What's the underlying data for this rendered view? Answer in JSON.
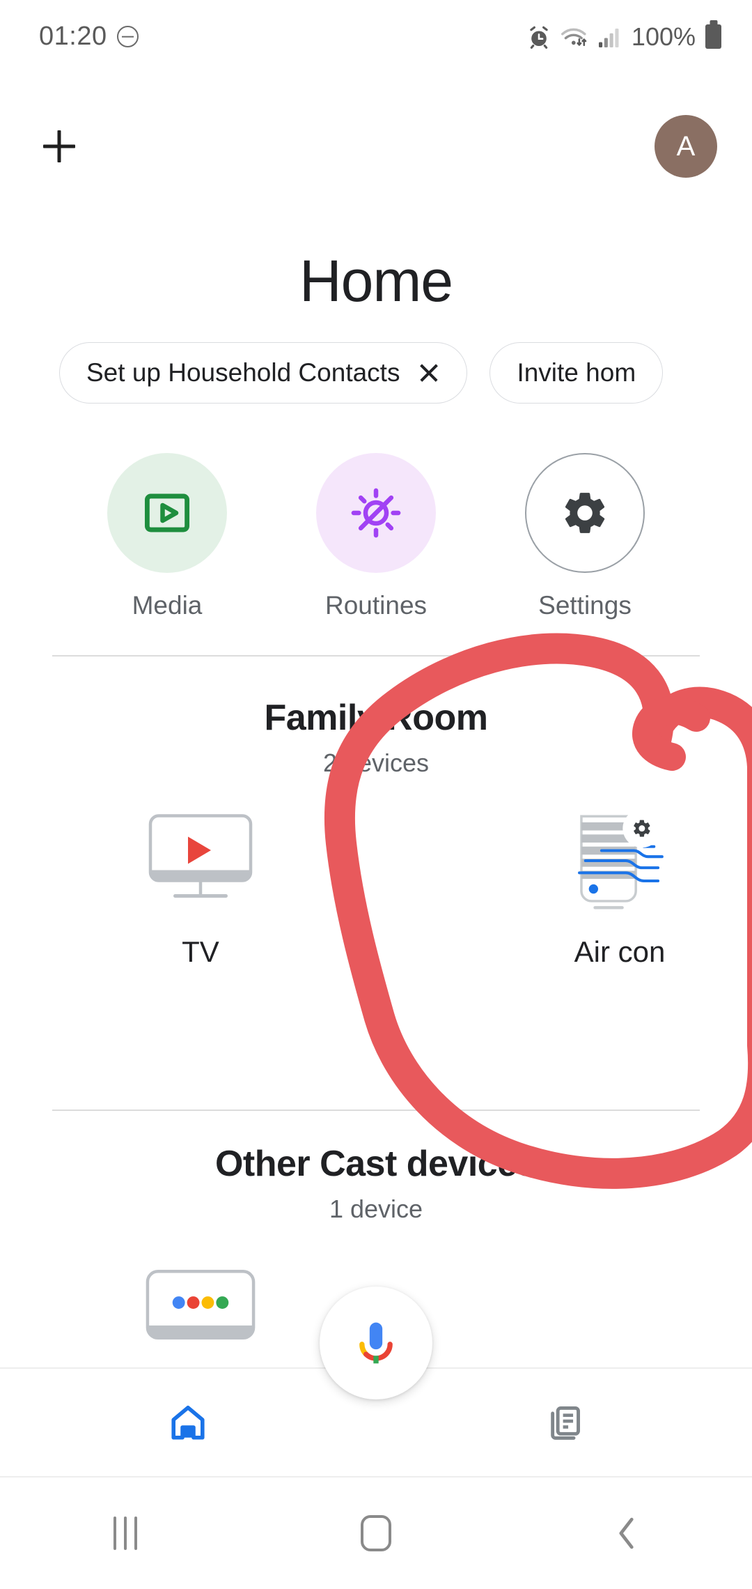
{
  "status_bar": {
    "time": "01:20",
    "dnd_icon": "do-not-disturb-icon",
    "alarm_icon": "alarm-icon",
    "wifi_icon": "wifi-icon",
    "signal_icon": "cellular-signal-icon",
    "battery_text": "100%",
    "battery_icon": "battery-full-icon"
  },
  "app_bar": {
    "add_icon": "plus-icon",
    "avatar_initial": "A"
  },
  "header": {
    "title": "Home"
  },
  "chips": [
    {
      "label": "Set up Household Contacts",
      "has_close": true,
      "close_icon": "close-icon"
    },
    {
      "label": "Invite hom",
      "has_close": false,
      "close_icon": ""
    }
  ],
  "quick_actions": [
    {
      "label": "Media",
      "icon": "media-play-icon",
      "circle_color": "#e3f1e6",
      "icon_color": "#1e8e3e"
    },
    {
      "label": "Routines",
      "icon": "routines-sun-icon",
      "circle_color": "#f5e6fb",
      "icon_color": "#a142f4"
    },
    {
      "label": "Settings",
      "icon": "gear-icon",
      "circle_color": "#ffffff",
      "icon_color": "#3c4043"
    }
  ],
  "sections": [
    {
      "title": "Family Room",
      "subtitle": "2 devices",
      "devices": [
        {
          "label": "TV",
          "icon": "tv-monitor-icon"
        },
        {
          "label": "Air con",
          "icon": "air-conditioner-icon"
        }
      ]
    },
    {
      "title": "Other Cast devices",
      "subtitle": "1 device",
      "devices": [
        {
          "label": "",
          "icon": "cast-device-icon"
        }
      ]
    }
  ],
  "mic_fab": {
    "icon": "google-assistant-mic-icon"
  },
  "bottom_nav": [
    {
      "icon": "home-icon",
      "active": true,
      "color": "#1a73e8"
    },
    {
      "icon": "feed-icon",
      "active": false,
      "color": "#80868b"
    }
  ],
  "system_nav": [
    {
      "icon": "recents-icon"
    },
    {
      "icon": "home-square-icon"
    },
    {
      "icon": "back-chevron-icon"
    }
  ],
  "annotation": {
    "type": "hand-drawn-circle",
    "color": "#e8595c",
    "target": "Air con"
  },
  "colors": {
    "accent_blue": "#1a73e8",
    "text_primary": "#202124",
    "text_secondary": "#5f6368",
    "divider": "#dcdcdc",
    "annotation_red": "#e8595c"
  }
}
